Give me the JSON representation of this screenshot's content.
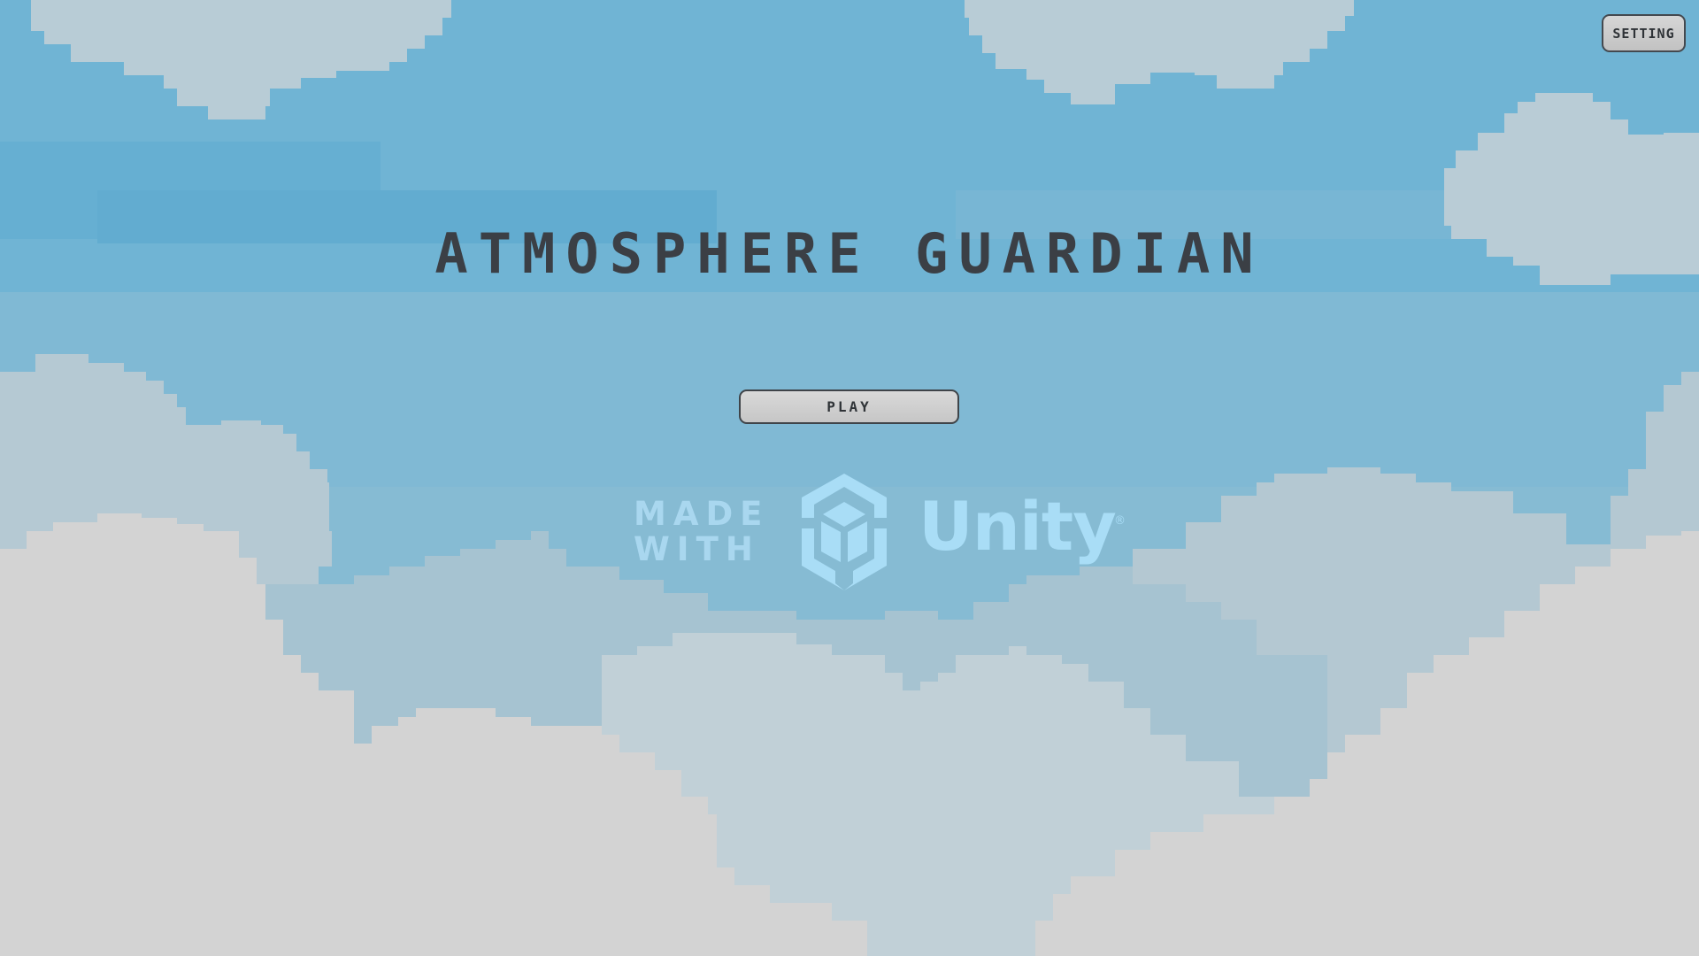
{
  "game": {
    "title": "ATMOSPHERE GUARDIAN",
    "play_label": "PLAY",
    "setting_label": "SETTING"
  },
  "splash": {
    "made_with_line1": "MADE",
    "made_with_line2": "WITH",
    "engine_name": "Unity",
    "registered_mark": "®"
  },
  "colors": {
    "sky": "#6fb3d3",
    "cloud_far": "#a9c6d4",
    "cloud_mid": "#bccdd5",
    "cloud_near": "#d4d4d4",
    "title_text": "#3b3f45",
    "button_fill": "#cfcfcf",
    "logo": "#a9ddf6"
  }
}
